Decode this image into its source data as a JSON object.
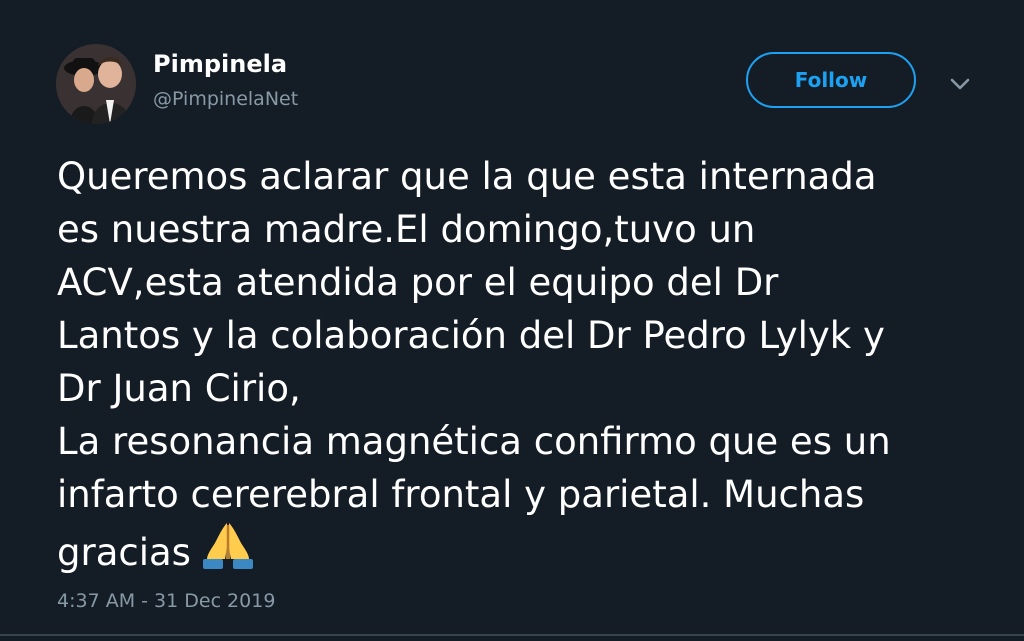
{
  "author": {
    "display_name": "Pimpinela",
    "handle": "@PimpinelaNet",
    "avatar_icon": "profile-photo-avatar"
  },
  "actions": {
    "follow_label": "Follow",
    "more_icon": "chevron-down-icon"
  },
  "tweet": {
    "lines": [
      "Queremos aclarar que la que esta internada",
      "es nuestra madre.El domingo,tuvo un",
      "ACV,esta atendida por el equipo del Dr",
      "Lantos y la colaboración del Dr Pedro Lylyk y",
      "Dr Juan Cirio,",
      "La resonancia magnética confirmo que es un",
      "infarto cererebral frontal y parietal. Muchas",
      "gracias"
    ],
    "emoji": "folded-hands-emoji",
    "timestamp": "4:37 AM - 31 Dec 2019"
  },
  "colors": {
    "background": "#141d26",
    "text": "#ffffff",
    "secondary_text": "#8899a6",
    "accent": "#1da1f2"
  }
}
